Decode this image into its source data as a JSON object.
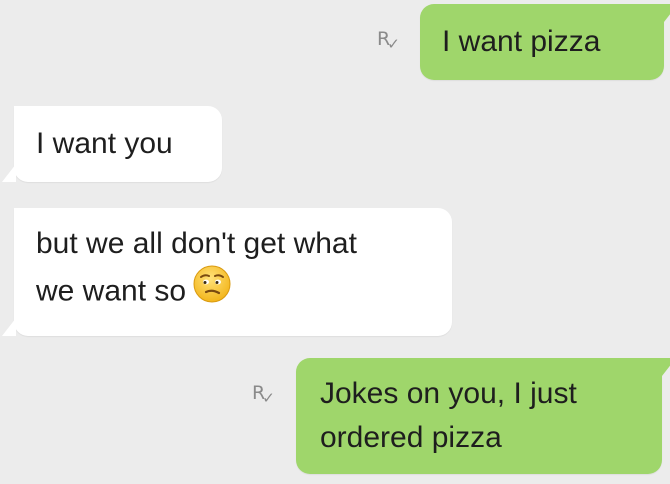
{
  "messages": [
    {
      "direction": "outgoing",
      "lines": [
        "I want pizza"
      ],
      "receipt": "R"
    },
    {
      "direction": "incoming",
      "lines": [
        "I want you"
      ]
    },
    {
      "direction": "incoming",
      "lines": [
        "but we all don't get what",
        "we want so"
      ],
      "emoji": "confused-face-emoji"
    },
    {
      "direction": "outgoing",
      "lines": [
        "Jokes on you, I just",
        "ordered pizza"
      ],
      "receipt": "R"
    }
  ],
  "colors": {
    "background": "#ececec",
    "outgoing_bubble": "#9fd66b",
    "incoming_bubble": "#ffffff",
    "text": "#1e1e1e",
    "receipt": "#8a8a8a"
  },
  "icons": {
    "read_receipt": "read-receipt-icon",
    "emoji": "confused-face-emoji"
  }
}
